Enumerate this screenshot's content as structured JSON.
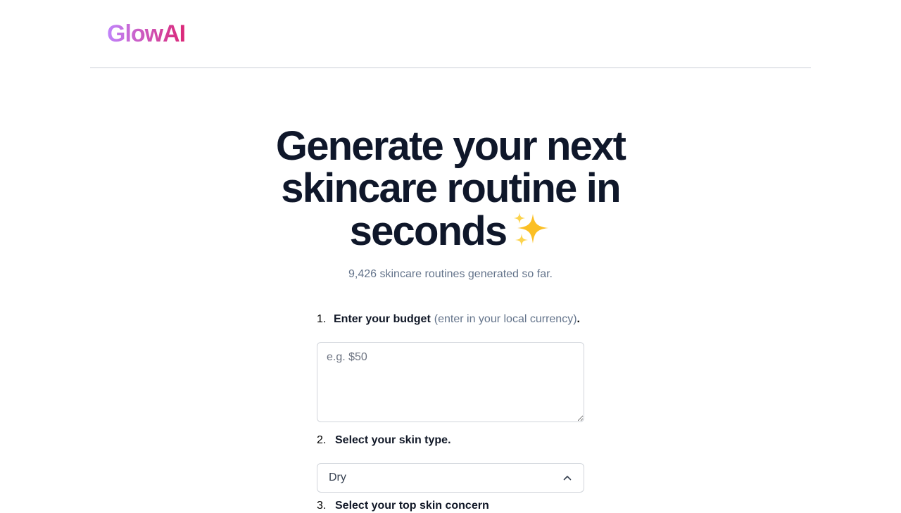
{
  "header": {
    "logo": "GlowAI"
  },
  "hero": {
    "title_line1": "Generate your next",
    "title_line2": "skincare routine in",
    "title_line3": "seconds",
    "counter": "9,426 skincare routines generated so far."
  },
  "steps": [
    {
      "number": "1.",
      "label": "Enter your budget",
      "hint": "(enter in your local currency)",
      "suffix": "."
    },
    {
      "number": "2.",
      "label": "Select your skin type."
    },
    {
      "number": "3.",
      "label": "Select your top skin concern"
    }
  ],
  "budget": {
    "placeholder": "e.g. $50",
    "value": ""
  },
  "skin_type": {
    "selected": "Dry",
    "icon": "chevron-up-icon"
  },
  "colors": {
    "logo_gradient_start": "#c084fc",
    "logo_gradient_end": "#db2777",
    "title": "#0f172a",
    "muted": "#64748b",
    "border": "#d1d5db"
  }
}
